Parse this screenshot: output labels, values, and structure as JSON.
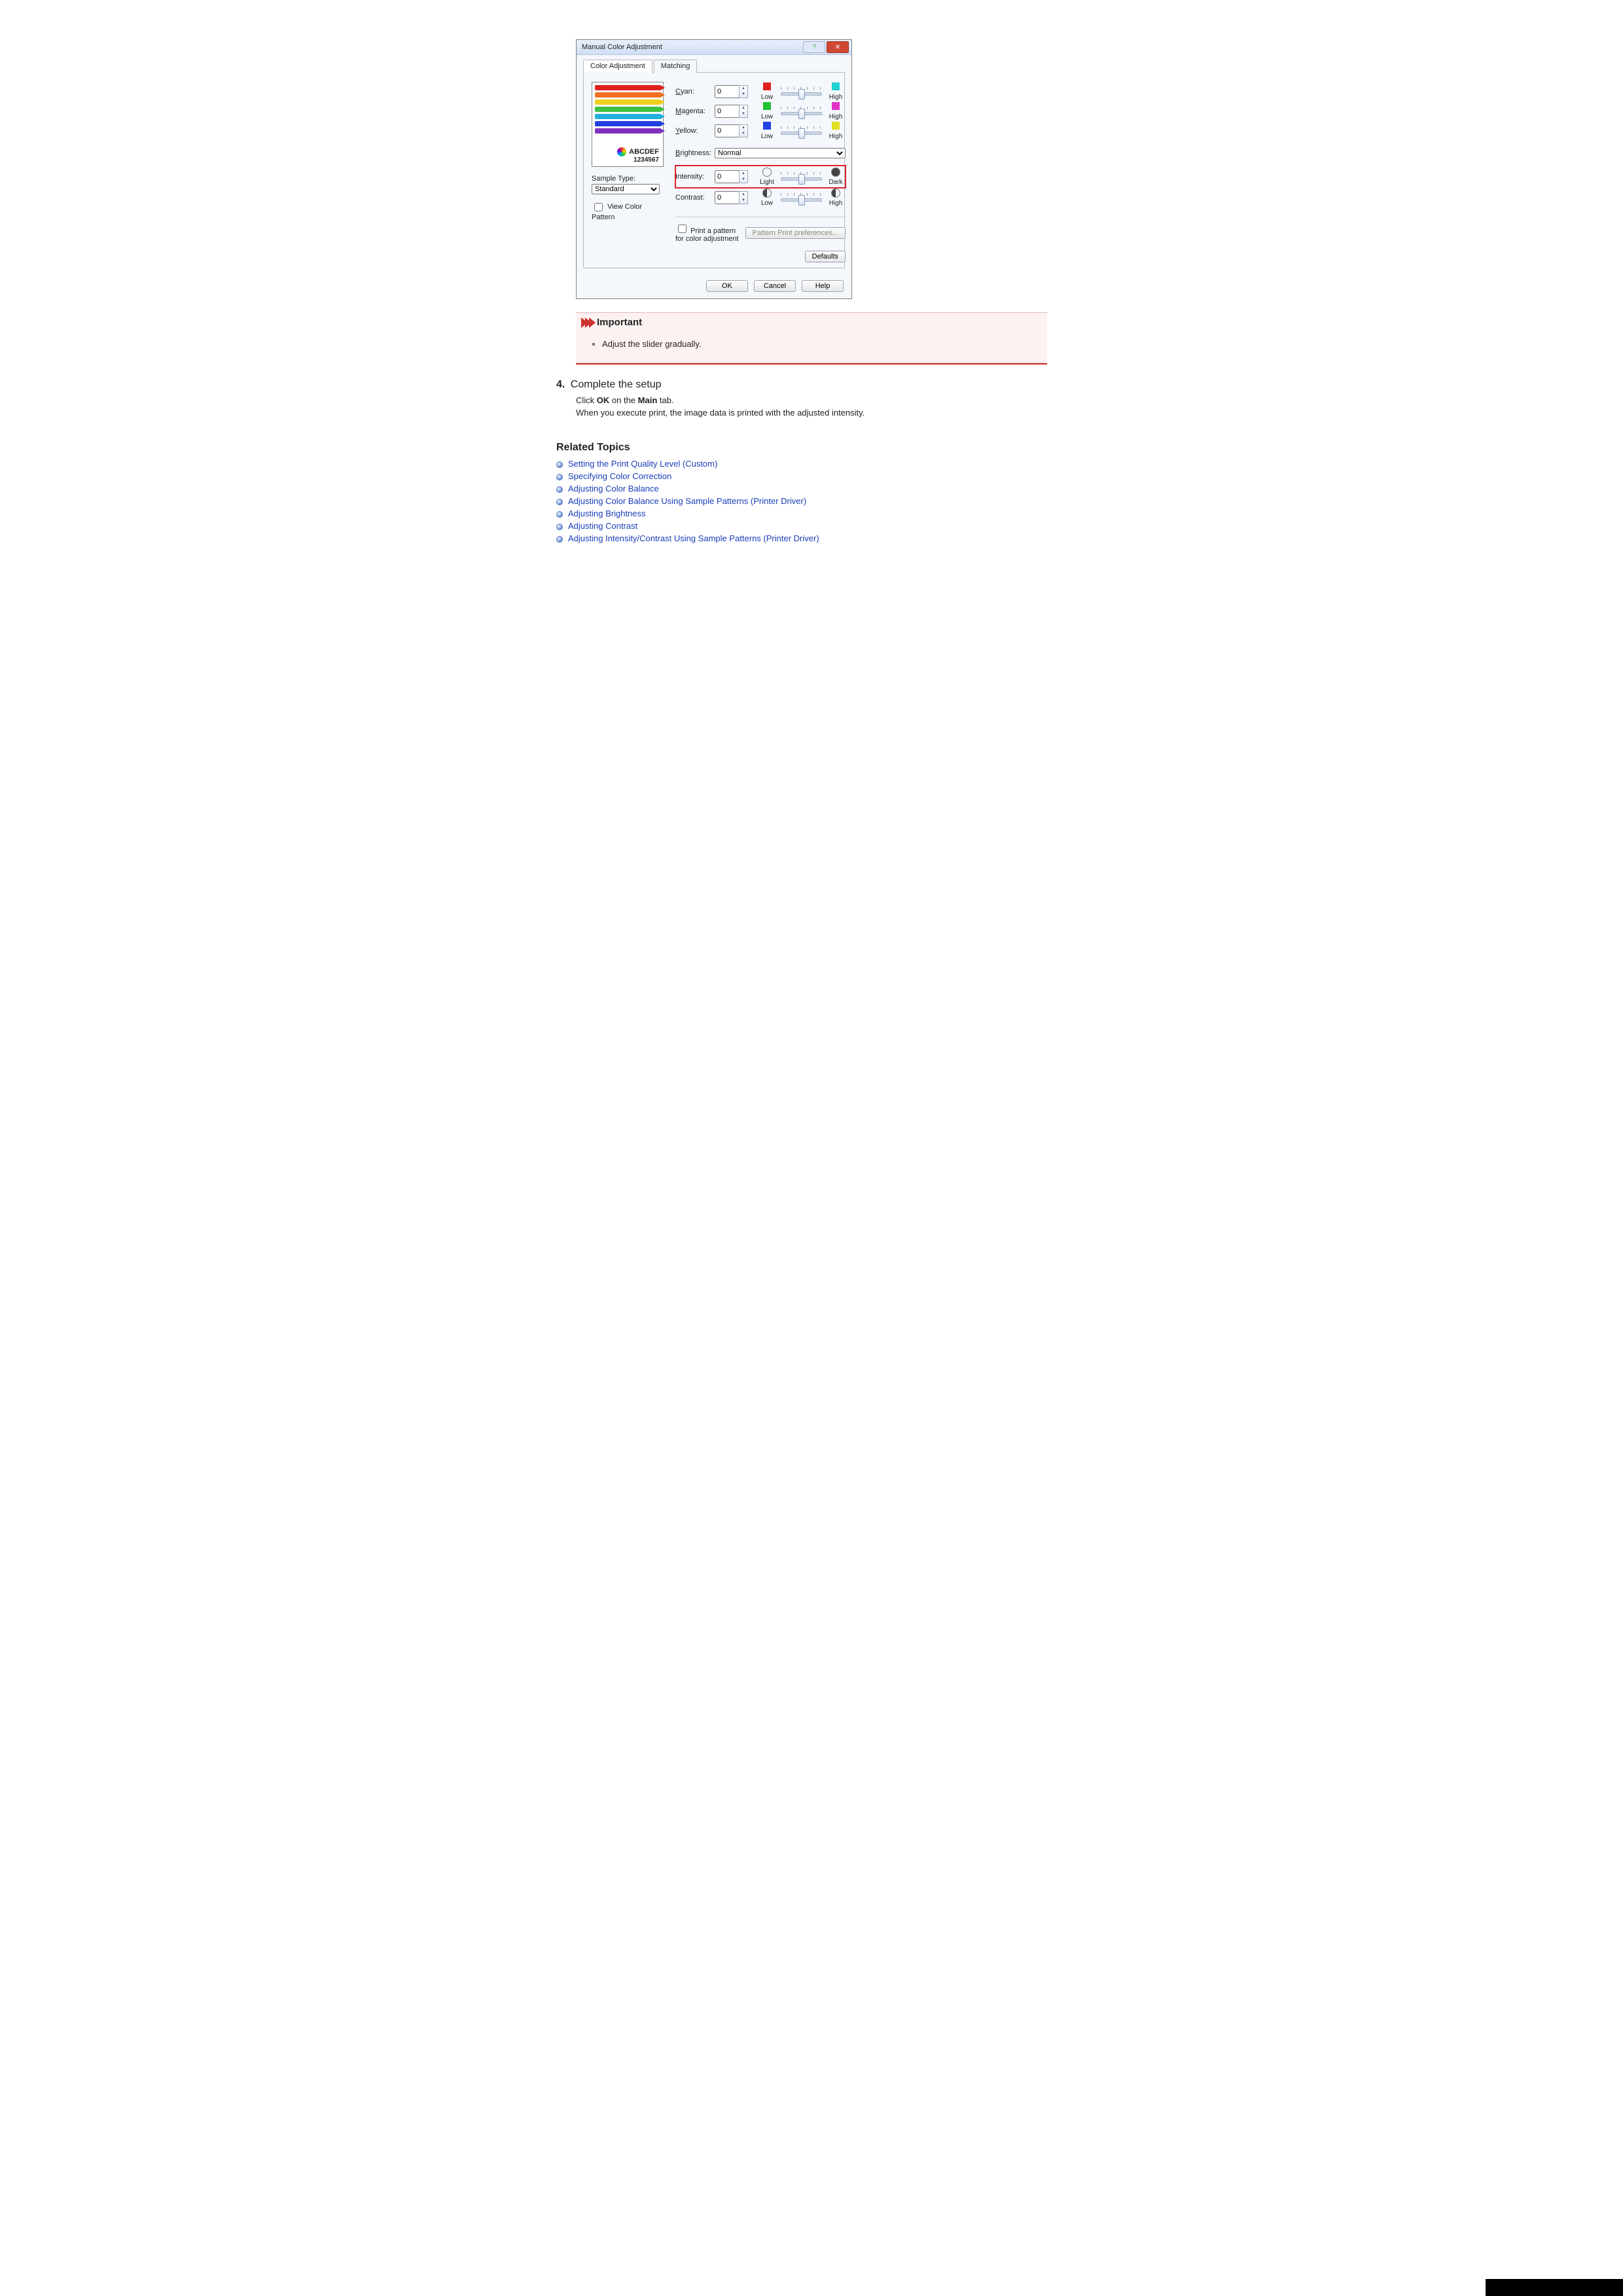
{
  "dialog": {
    "title": "Manual Color Adjustment",
    "tabs": {
      "active": "Color Adjustment",
      "inactive": "Matching"
    },
    "preview_text1": "ABCDEF",
    "preview_text2": "1234567",
    "sample_type_label": "Sample Type:",
    "sample_type_value": "Standard",
    "view_color_pattern": "View Color Pattern",
    "rows": {
      "cyan": {
        "label": "Cyan:",
        "value": "0",
        "low": "Low",
        "high": "High",
        "low_color": "#e02020",
        "high_color": "#20d2d2"
      },
      "magenta": {
        "label": "Magenta:",
        "value": "0",
        "low": "Low",
        "high": "High",
        "low_color": "#20c030",
        "high_color": "#e030c8"
      },
      "yellow": {
        "label": "Yellow:",
        "value": "0",
        "low": "Low",
        "high": "High",
        "low_color": "#2040e0",
        "high_color": "#e0e020"
      },
      "brightness": {
        "label": "Brightness:",
        "value": "Normal"
      },
      "intensity": {
        "label": "Intensity:",
        "value": "0",
        "low": "Light",
        "high": "Dark"
      },
      "contrast": {
        "label": "Contrast:",
        "value": "0",
        "low": "Low",
        "high": "High"
      }
    },
    "pattern_checkbox": "Print a pattern for color adjustment",
    "pattern_button": "Pattern Print preferences...",
    "defaults": "Defaults",
    "buttons": {
      "ok": "OK",
      "cancel": "Cancel",
      "help": "Help"
    }
  },
  "important": {
    "heading": "Important",
    "item": "Adjust the slider gradually."
  },
  "step": {
    "number": "4.",
    "title": "Complete the setup",
    "line1a": "Click ",
    "line1b": "OK",
    "line1c": " on the ",
    "line1d": "Main",
    "line1e": " tab.",
    "line2": "When you execute print, the image data is printed with the adjusted intensity."
  },
  "related": {
    "heading": "Related Topics",
    "links": [
      "Setting the Print Quality Level (Custom)",
      "Specifying Color Correction",
      "Adjusting Color Balance",
      "Adjusting Color Balance Using Sample Patterns (Printer Driver)",
      "Adjusting Brightness",
      "Adjusting Contrast",
      "Adjusting Intensity/Contrast Using Sample Patterns (Printer Driver)"
    ]
  },
  "pencil_colors": [
    "#e02020",
    "#f07020",
    "#f0d020",
    "#40c040",
    "#20b0e0",
    "#2040e0",
    "#8030c0"
  ]
}
